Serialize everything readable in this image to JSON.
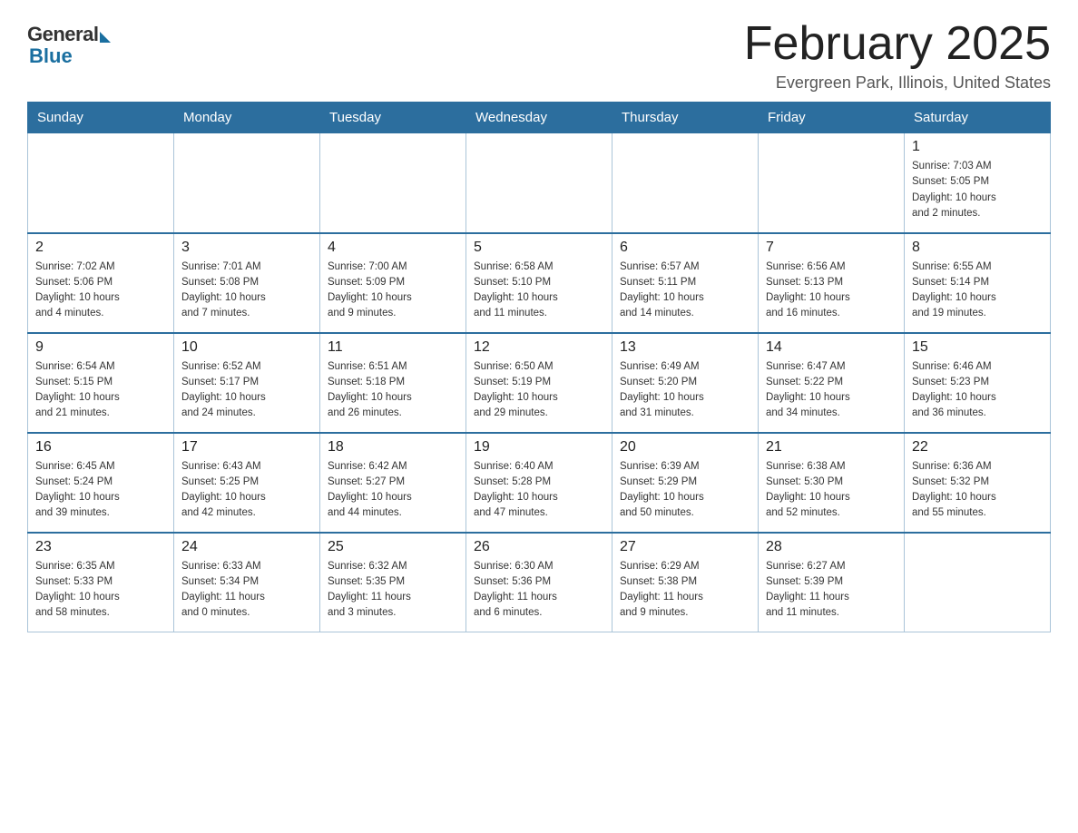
{
  "logo": {
    "general": "General",
    "blue": "Blue"
  },
  "title": "February 2025",
  "location": "Evergreen Park, Illinois, United States",
  "days_of_week": [
    "Sunday",
    "Monday",
    "Tuesday",
    "Wednesday",
    "Thursday",
    "Friday",
    "Saturday"
  ],
  "weeks": [
    [
      {
        "day": "",
        "info": ""
      },
      {
        "day": "",
        "info": ""
      },
      {
        "day": "",
        "info": ""
      },
      {
        "day": "",
        "info": ""
      },
      {
        "day": "",
        "info": ""
      },
      {
        "day": "",
        "info": ""
      },
      {
        "day": "1",
        "info": "Sunrise: 7:03 AM\nSunset: 5:05 PM\nDaylight: 10 hours\nand 2 minutes."
      }
    ],
    [
      {
        "day": "2",
        "info": "Sunrise: 7:02 AM\nSunset: 5:06 PM\nDaylight: 10 hours\nand 4 minutes."
      },
      {
        "day": "3",
        "info": "Sunrise: 7:01 AM\nSunset: 5:08 PM\nDaylight: 10 hours\nand 7 minutes."
      },
      {
        "day": "4",
        "info": "Sunrise: 7:00 AM\nSunset: 5:09 PM\nDaylight: 10 hours\nand 9 minutes."
      },
      {
        "day": "5",
        "info": "Sunrise: 6:58 AM\nSunset: 5:10 PM\nDaylight: 10 hours\nand 11 minutes."
      },
      {
        "day": "6",
        "info": "Sunrise: 6:57 AM\nSunset: 5:11 PM\nDaylight: 10 hours\nand 14 minutes."
      },
      {
        "day": "7",
        "info": "Sunrise: 6:56 AM\nSunset: 5:13 PM\nDaylight: 10 hours\nand 16 minutes."
      },
      {
        "day": "8",
        "info": "Sunrise: 6:55 AM\nSunset: 5:14 PM\nDaylight: 10 hours\nand 19 minutes."
      }
    ],
    [
      {
        "day": "9",
        "info": "Sunrise: 6:54 AM\nSunset: 5:15 PM\nDaylight: 10 hours\nand 21 minutes."
      },
      {
        "day": "10",
        "info": "Sunrise: 6:52 AM\nSunset: 5:17 PM\nDaylight: 10 hours\nand 24 minutes."
      },
      {
        "day": "11",
        "info": "Sunrise: 6:51 AM\nSunset: 5:18 PM\nDaylight: 10 hours\nand 26 minutes."
      },
      {
        "day": "12",
        "info": "Sunrise: 6:50 AM\nSunset: 5:19 PM\nDaylight: 10 hours\nand 29 minutes."
      },
      {
        "day": "13",
        "info": "Sunrise: 6:49 AM\nSunset: 5:20 PM\nDaylight: 10 hours\nand 31 minutes."
      },
      {
        "day": "14",
        "info": "Sunrise: 6:47 AM\nSunset: 5:22 PM\nDaylight: 10 hours\nand 34 minutes."
      },
      {
        "day": "15",
        "info": "Sunrise: 6:46 AM\nSunset: 5:23 PM\nDaylight: 10 hours\nand 36 minutes."
      }
    ],
    [
      {
        "day": "16",
        "info": "Sunrise: 6:45 AM\nSunset: 5:24 PM\nDaylight: 10 hours\nand 39 minutes."
      },
      {
        "day": "17",
        "info": "Sunrise: 6:43 AM\nSunset: 5:25 PM\nDaylight: 10 hours\nand 42 minutes."
      },
      {
        "day": "18",
        "info": "Sunrise: 6:42 AM\nSunset: 5:27 PM\nDaylight: 10 hours\nand 44 minutes."
      },
      {
        "day": "19",
        "info": "Sunrise: 6:40 AM\nSunset: 5:28 PM\nDaylight: 10 hours\nand 47 minutes."
      },
      {
        "day": "20",
        "info": "Sunrise: 6:39 AM\nSunset: 5:29 PM\nDaylight: 10 hours\nand 50 minutes."
      },
      {
        "day": "21",
        "info": "Sunrise: 6:38 AM\nSunset: 5:30 PM\nDaylight: 10 hours\nand 52 minutes."
      },
      {
        "day": "22",
        "info": "Sunrise: 6:36 AM\nSunset: 5:32 PM\nDaylight: 10 hours\nand 55 minutes."
      }
    ],
    [
      {
        "day": "23",
        "info": "Sunrise: 6:35 AM\nSunset: 5:33 PM\nDaylight: 10 hours\nand 58 minutes."
      },
      {
        "day": "24",
        "info": "Sunrise: 6:33 AM\nSunset: 5:34 PM\nDaylight: 11 hours\nand 0 minutes."
      },
      {
        "day": "25",
        "info": "Sunrise: 6:32 AM\nSunset: 5:35 PM\nDaylight: 11 hours\nand 3 minutes."
      },
      {
        "day": "26",
        "info": "Sunrise: 6:30 AM\nSunset: 5:36 PM\nDaylight: 11 hours\nand 6 minutes."
      },
      {
        "day": "27",
        "info": "Sunrise: 6:29 AM\nSunset: 5:38 PM\nDaylight: 11 hours\nand 9 minutes."
      },
      {
        "day": "28",
        "info": "Sunrise: 6:27 AM\nSunset: 5:39 PM\nDaylight: 11 hours\nand 11 minutes."
      },
      {
        "day": "",
        "info": ""
      }
    ]
  ]
}
